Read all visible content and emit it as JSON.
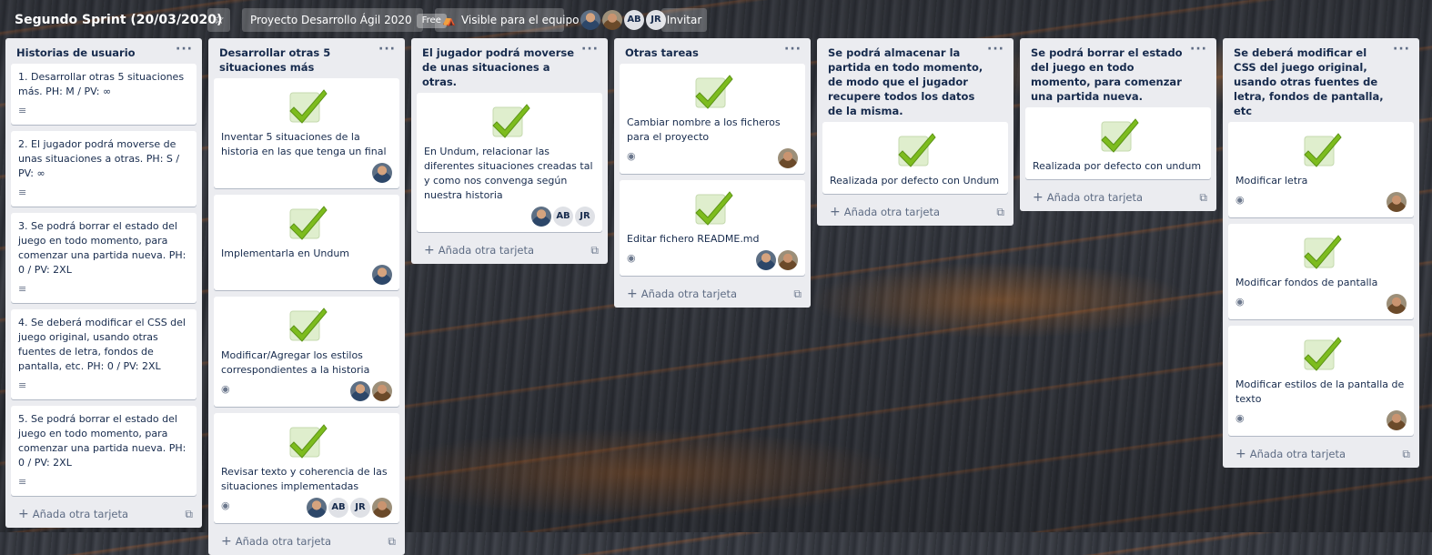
{
  "board": {
    "title": "Segundo Sprint (20/03/2020)",
    "star_icon": "☆",
    "project": "Proyecto Desarrollo Ágil 2020",
    "plan": "Free",
    "visibility": "Visible para el equipo",
    "visibility_icon": "⛺",
    "invite": "Invitar",
    "members": [
      {
        "type": "photo",
        "name": ""
      },
      {
        "type": "photo2",
        "name": ""
      },
      {
        "type": "initials",
        "initials": "AB"
      },
      {
        "type": "initials",
        "initials": "JR"
      }
    ]
  },
  "ui": {
    "list_menu": "···",
    "add_card": "Añada otra tarjeta",
    "add_plus": "+",
    "template_icon": "⧉",
    "desc_icon": "≡",
    "watch_icon": "◉"
  },
  "colors": {
    "check_green": "#7dbc1e",
    "check_box": "#dfeecd",
    "list_bg": "#ebecf0"
  },
  "lists": [
    {
      "title": "Historias de usuario",
      "cards": [
        {
          "title": "1. Desarrollar otras 5 situaciones más. PH: M / PV: ∞",
          "badge": "desc"
        },
        {
          "title": "2. El jugador podrá moverse de unas situaciones a otras. PH: S / PV: ∞",
          "badge": "desc"
        },
        {
          "title": "3. Se podrá borrar el estado del juego en todo momento, para comenzar una partida nueva. PH: 0 / PV: 2XL",
          "badge": "desc"
        },
        {
          "title": "4. Se deberá modificar el CSS del juego original, usando otras fuentes de letra, fondos de pantalla, etc. PH: 0 / PV: 2XL",
          "badge": "desc"
        },
        {
          "title": "5. Se podrá borrar el estado del juego en todo momento, para comenzar una partida nueva. PH: 0 / PV: 2XL",
          "badge": "desc"
        }
      ]
    },
    {
      "title": "Desarrollar otras 5 situaciones más",
      "cards": [
        {
          "cover": true,
          "title": "Inventar 5 situaciones de la historia en las que tenga un final",
          "members": [
            "photo"
          ]
        },
        {
          "cover": true,
          "title": "Implementarla en Undum",
          "members": [
            "photo"
          ]
        },
        {
          "cover": true,
          "title": "Modificar/Agregar los estilos correspondientes a la historia",
          "badge": "watch",
          "members": [
            "photo",
            "photo2"
          ]
        },
        {
          "cover": true,
          "title": "Revisar texto y coherencia de las situaciones implementadas",
          "badge": "watch",
          "members": [
            "photo",
            "AB",
            "JR",
            "photo2"
          ]
        }
      ]
    },
    {
      "title": "El jugador podrá moverse de unas situaciones a otras.",
      "cards": [
        {
          "cover": true,
          "title": "En Undum, relacionar las diferentes situaciones creadas tal y como nos convenga según nuestra historia",
          "members": [
            "photo",
            "AB",
            "JR"
          ]
        }
      ]
    },
    {
      "title": "Otras tareas",
      "cards": [
        {
          "cover": true,
          "title": "Cambiar nombre a los ficheros para el proyecto",
          "badge": "watch",
          "members": [
            "photo2"
          ]
        },
        {
          "cover": true,
          "title": "Editar fichero README.md",
          "badge": "watch",
          "members": [
            "photo",
            "photo2"
          ]
        }
      ]
    },
    {
      "title": "Se podrá almacenar la partida en todo momento, de modo que el jugador recupere todos los datos de la misma.",
      "cards": [
        {
          "cover": true,
          "title": "Realizada por defecto con Undum"
        }
      ]
    },
    {
      "title": "Se podrá borrar el estado del juego en todo momento, para comenzar una partida nueva.",
      "cards": [
        {
          "cover": true,
          "title": "Realizada por defecto con undum"
        }
      ]
    },
    {
      "title": "Se deberá modificar el CSS del juego original, usando otras fuentes de letra, fondos de pantalla, etc",
      "cards": [
        {
          "cover": true,
          "title": "Modificar letra",
          "badge": "watch",
          "members": [
            "photo2"
          ]
        },
        {
          "cover": true,
          "title": "Modificar fondos de pantalla",
          "badge": "watch",
          "members": [
            "photo2"
          ]
        },
        {
          "cover": true,
          "title": "Modificar estilos de la pantalla de texto",
          "badge": "watch",
          "members": [
            "photo2"
          ]
        }
      ]
    }
  ]
}
